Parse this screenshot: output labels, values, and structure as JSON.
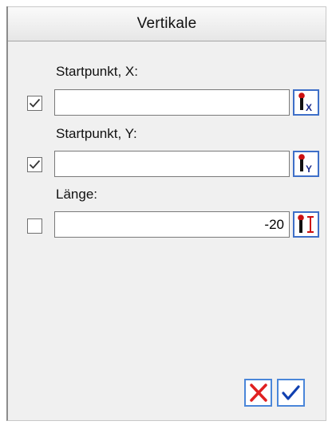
{
  "dialog": {
    "title": "Vertikale"
  },
  "fields": [
    {
      "label": "Startpunkt, X:",
      "value": "",
      "checked": true,
      "pick_icon": "point-x-pick-icon"
    },
    {
      "label": "Startpunkt, Y:",
      "value": "",
      "checked": true,
      "pick_icon": "point-y-pick-icon"
    },
    {
      "label": "Länge:",
      "value": "-20",
      "checked": false,
      "pick_icon": "length-pick-icon"
    }
  ],
  "buttons": {
    "cancel_icon": "x-cancel-icon",
    "ok_icon": "checkmark-ok-icon"
  },
  "colors": {
    "button_border": "#3e6fc8",
    "cancel_red": "#e02020",
    "ok_blue": "#1040b0"
  }
}
